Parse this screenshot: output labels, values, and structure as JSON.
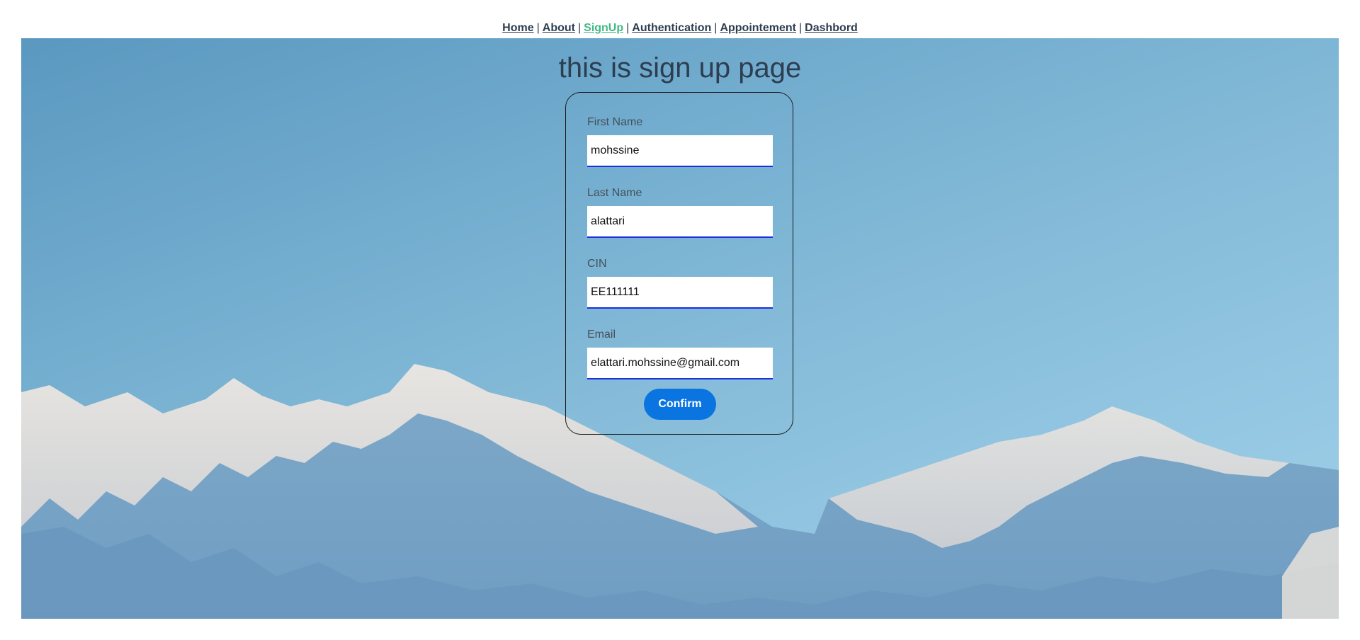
{
  "nav": {
    "links": [
      {
        "label": "Home",
        "active": false
      },
      {
        "label": "About",
        "active": false
      },
      {
        "label": "SignUp",
        "active": true
      },
      {
        "label": "Authentication",
        "active": false
      },
      {
        "label": "Appointement",
        "active": false
      },
      {
        "label": "Dashbord",
        "active": false
      }
    ],
    "separator": "|"
  },
  "page": {
    "title": "this is sign up page"
  },
  "form": {
    "first_name": {
      "label": "First Name",
      "value": "mohssine"
    },
    "last_name": {
      "label": "Last Name",
      "value": "alattari"
    },
    "cin": {
      "label": "CIN",
      "value": "EE111111"
    },
    "email": {
      "label": "Email",
      "value": "elattari.mohssine@gmail.com"
    },
    "confirm_label": "Confirm"
  },
  "colors": {
    "accent": "#0a74e0",
    "nav_active": "#42b983",
    "text": "#2c3e50"
  }
}
